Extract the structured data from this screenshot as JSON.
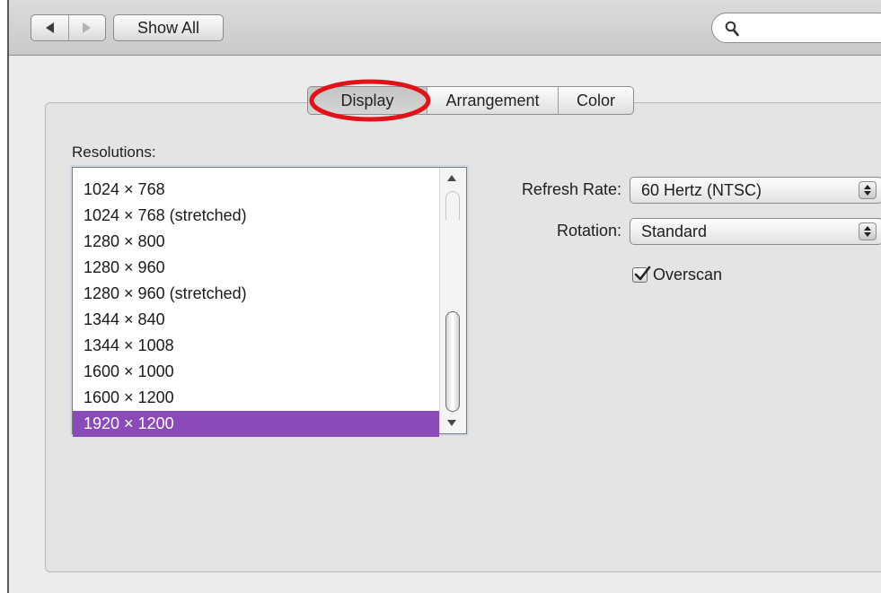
{
  "toolbar": {
    "back_icon": "chevron-left-icon",
    "forward_icon": "chevron-right-icon",
    "show_all_label": "Show All",
    "search_icon": "magnifier-icon",
    "search_value": ""
  },
  "tabs": [
    {
      "label": "Display",
      "selected": true
    },
    {
      "label": "Arrangement",
      "selected": false
    },
    {
      "label": "Color",
      "selected": false
    }
  ],
  "annotation": {
    "highlight_color": "#e0131a"
  },
  "resolutions": {
    "label": "Resolutions:",
    "items": [
      "1024 × 768",
      "1024 × 768 (stretched)",
      "1280 × 800",
      "1280 × 960",
      "1280 × 960 (stretched)",
      "1344 × 840",
      "1344 × 1008",
      "1600 × 1000",
      "1600 × 1200",
      "1920 × 1200"
    ],
    "selected_index": 9,
    "selection_color": "#8a4bb8"
  },
  "refresh_rate": {
    "label": "Refresh Rate:",
    "value": "60 Hertz (NTSC)"
  },
  "rotation": {
    "label": "Rotation:",
    "value": "Standard"
  },
  "overscan": {
    "label": "Overscan",
    "checked": true
  }
}
